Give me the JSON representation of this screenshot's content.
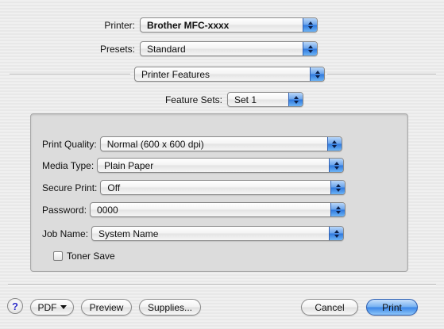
{
  "printer": {
    "label": "Printer:",
    "value": "Brother MFC-xxxx"
  },
  "presets": {
    "label": "Presets:",
    "value": "Standard"
  },
  "pane": {
    "value": "Printer Features"
  },
  "feature_sets": {
    "label": "Feature Sets:",
    "value": "Set 1"
  },
  "settings": {
    "print_quality": {
      "label": "Print Quality:",
      "value": "Normal (600 x 600 dpi)"
    },
    "media_type": {
      "label": "Media Type:",
      "value": "Plain Paper"
    },
    "secure_print": {
      "label": "Secure Print:",
      "value": "Off"
    },
    "password": {
      "label": "Password:",
      "value": "0000"
    },
    "job_name": {
      "label": "Job Name:",
      "value": "System Name"
    },
    "toner_save": {
      "label": "Toner Save",
      "checked": false
    }
  },
  "footer": {
    "help": "?",
    "pdf": "PDF",
    "preview": "Preview",
    "supplies": "Supplies...",
    "cancel": "Cancel",
    "print": "Print"
  },
  "colors": {
    "accent": "#3b86e6"
  }
}
